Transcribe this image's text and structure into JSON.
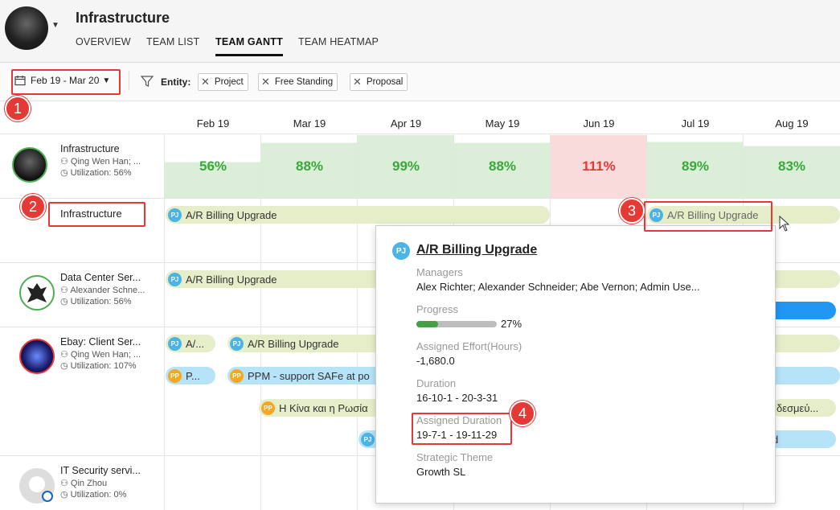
{
  "header": {
    "title": "Infrastructure",
    "tabs": [
      {
        "label": "OVERVIEW"
      },
      {
        "label": "TEAM LIST"
      },
      {
        "label": "TEAM GANTT"
      },
      {
        "label": "TEAM HEATMAP"
      }
    ]
  },
  "filters": {
    "date_range": "Feb 19 - Mar 20",
    "entity_label": "Entity:",
    "chips": [
      "Project",
      "Free Standing",
      "Proposal"
    ]
  },
  "months": [
    "Feb 19",
    "Mar 19",
    "Apr 19",
    "May 19",
    "Jun 19",
    "Jul 19",
    "Aug 19"
  ],
  "utilization_row": [
    "56%",
    "88%",
    "99%",
    "88%",
    "111%",
    "89%",
    "83%"
  ],
  "resources": [
    {
      "name": "Infrastructure",
      "people": "Qing Wen Han; ...",
      "utilization": "Utilization: 56%"
    },
    {
      "name": "Data Center Ser...",
      "people": "Alexander Schne...",
      "utilization": "Utilization: 56%"
    },
    {
      "name": "Ebay: Client Ser...",
      "people": "Qing Wen Han; ...",
      "utilization": "Utilization: 107%"
    },
    {
      "name": "IT Security servi...",
      "people": "Qin Zhou",
      "utilization": "Utilization: 0%"
    }
  ],
  "sub_label": "Infrastructure",
  "bars": {
    "ar_billing": "A/R Billing Upgrade",
    "ar_short": "A/...",
    "p_short": "P...",
    "ppm": "PPM - support SAFe at po",
    "greek": "Η Κίνα και η Ρωσία",
    "greek_right": "δεσμεύ...",
    "d_tail": "d",
    "pj": "PJ",
    "pp": "PP"
  },
  "tooltip": {
    "title": "A/R Billing Upgrade",
    "badge": "PJ",
    "managers_label": "Managers",
    "managers": "Alex Richter; Alexander Schneider; Abe Vernon; Admin Use...",
    "progress_label": "Progress",
    "progress_value": "27%",
    "progress_fraction": 0.27,
    "effort_label": "Assigned Effort(Hours)",
    "effort": "-1,680.0",
    "duration_label": "Duration",
    "duration": "16-10-1 - 20-3-31",
    "assigned_duration_label": "Assigned Duration",
    "assigned_duration": "19-7-1 - 19-11-29",
    "theme_label": "Strategic Theme",
    "theme": "Growth SL"
  },
  "annotations": [
    "1",
    "2",
    "3",
    "4"
  ],
  "colors": {
    "annotation": "#e53935",
    "ok": "#3aa83a",
    "over": "#e53935",
    "bar_green": "#e6eec9",
    "bar_blue": "#b6e3f8",
    "accent": "#2196f3"
  }
}
